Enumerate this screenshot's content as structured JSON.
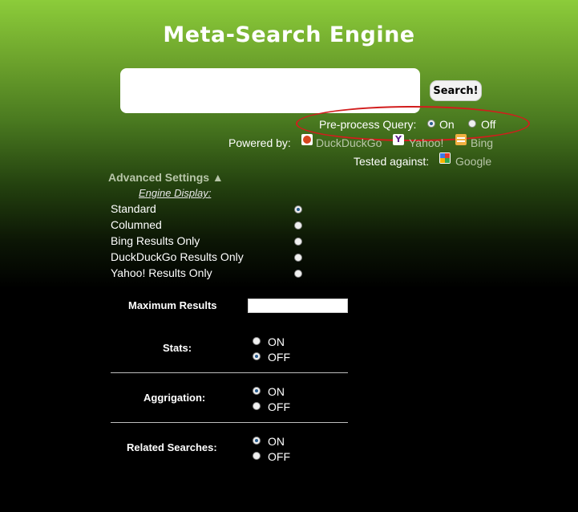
{
  "header": {
    "title": "Meta-Search Engine"
  },
  "search": {
    "value": "",
    "button_label": "Search!"
  },
  "preprocess": {
    "label": "Pre-process Query:",
    "on_label": "On",
    "off_label": "Off",
    "selected": "On",
    "highlight_color": "#d21d1d"
  },
  "powered_by": {
    "label": "Powered by:",
    "engines": [
      "DuckDuckGo",
      "Yahoo!",
      "Bing"
    ]
  },
  "tested_against": {
    "label": "Tested against:",
    "engine": "Google"
  },
  "advanced": {
    "toggle_label": "Advanced Settings ▲",
    "engine_display_label": "Engine Display:",
    "options": [
      "Standard",
      "Columned",
      "Bing Results Only",
      "DuckDuckGo Results Only",
      "Yahoo! Results Only"
    ],
    "selected": "Standard",
    "max_results_label": "Maximum Results",
    "max_results_value": "",
    "stats": {
      "label": "Stats:",
      "on": "ON",
      "off": "OFF",
      "selected": "OFF"
    },
    "aggregation": {
      "label": "Aggrigation:",
      "on": "ON",
      "off": "OFF",
      "selected": "ON"
    },
    "related": {
      "label": "Related Searches:",
      "on": "ON",
      "off": "OFF",
      "selected": "ON"
    }
  }
}
